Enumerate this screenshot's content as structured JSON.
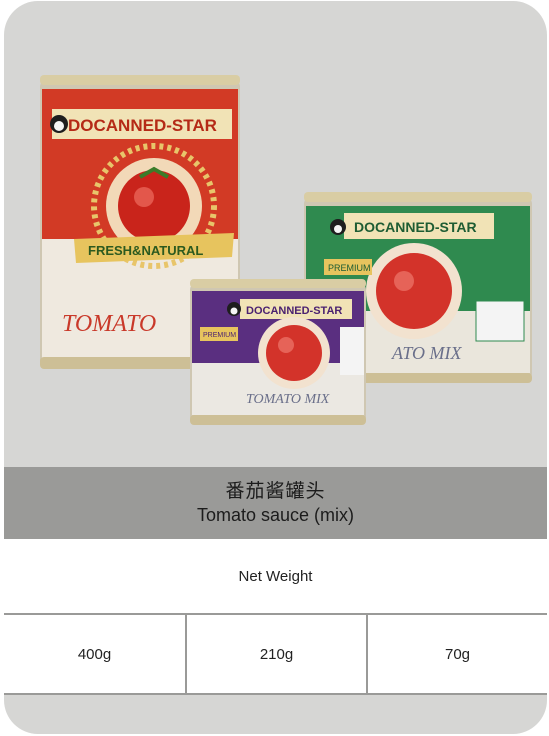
{
  "product": {
    "title_cn": "番茄酱罐头",
    "title_en": "Tomato sauce (mix)"
  },
  "cans": {
    "brand": "DOCANNED-STAR",
    "large_ribbon": "FRESH&NATURAL",
    "large_label": "TOMATO",
    "small_label": "TOMATO MIX",
    "medium_label": "ATO MIX",
    "medium_tag": "PREMIUM",
    "small_tag": "PREMIUM"
  },
  "table": {
    "net_weight_label": "Net Weight",
    "weights": [
      "400g",
      "210g",
      "70g"
    ]
  },
  "colors": {
    "card_bg": "#d6d6d4",
    "title_band": "#9a9a98",
    "can_red": "#d23a25",
    "can_green": "#2f8a4f",
    "can_purple": "#5a2f80"
  }
}
